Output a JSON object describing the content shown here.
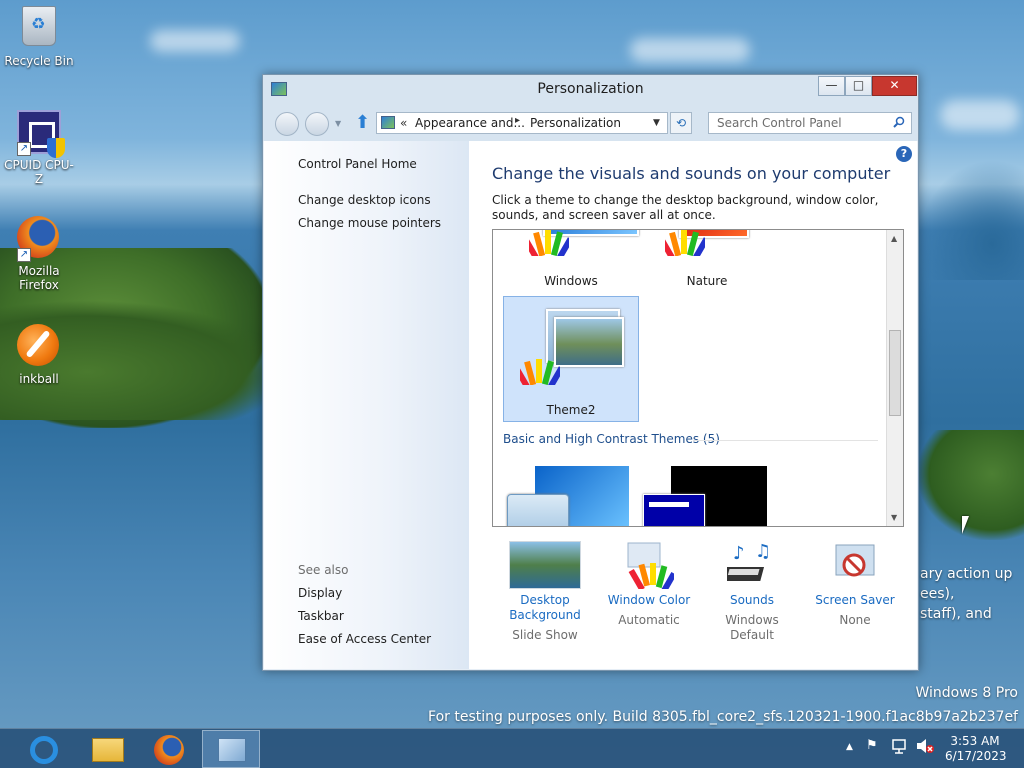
{
  "desktop": {
    "icons": [
      {
        "label": "Recycle Bin"
      },
      {
        "label": "CPUID CPU-Z"
      },
      {
        "label": "Mozilla Firefox"
      },
      {
        "label": "inkball"
      }
    ],
    "bleed_text": [
      "ary action up",
      "ees),",
      "staff), and"
    ],
    "watermark": {
      "line1": "Windows 8 Pro",
      "line2": "For testing purposes only. Build 8305.fbl_core2_sfs.120321-1900.f1ac8b97a2b237ef"
    }
  },
  "window": {
    "title": "Personalization",
    "controls": {
      "minimize": "—",
      "maximize": "□",
      "close": "✕"
    },
    "address": {
      "chevron": "«",
      "segment1": "Appearance and...",
      "separator": "▸",
      "segment2": "Personalization"
    },
    "search": {
      "placeholder": "Search Control Panel"
    },
    "sidebar": {
      "home": "Control Panel Home",
      "links": [
        "Change desktop icons",
        "Change mouse pointers"
      ],
      "see_also_label": "See also",
      "see_also": [
        "Display",
        "Taskbar",
        "Ease of Access Center"
      ]
    },
    "main": {
      "title": "Change the visuals and sounds on your computer",
      "description": "Click a theme to change the desktop background, window color, sounds, and screen saver all at once.",
      "themes": [
        "Windows",
        "Nature",
        "Theme2"
      ],
      "selected_theme": "Theme2",
      "group_title": "Basic and High Contrast Themes (5)"
    },
    "bottom": [
      {
        "label": "Desktop Background",
        "value": "Slide Show"
      },
      {
        "label": "Window Color",
        "value": "Automatic"
      },
      {
        "label": "Sounds",
        "value": "Windows Default"
      },
      {
        "label": "Screen Saver",
        "value": "None"
      }
    ],
    "help_icon": "?"
  },
  "taskbar": {
    "apps": [
      "internet-explorer",
      "file-explorer",
      "firefox",
      "control-panel"
    ],
    "active_app": "control-panel",
    "clock": {
      "time": "3:53 AM",
      "date": "6/17/2023"
    }
  },
  "colors": {
    "link": "#1a6bc2",
    "title_blue": "#1e3b6f",
    "close_red": "#c7372f",
    "selected_theme_bg": "#cfe3fb"
  }
}
